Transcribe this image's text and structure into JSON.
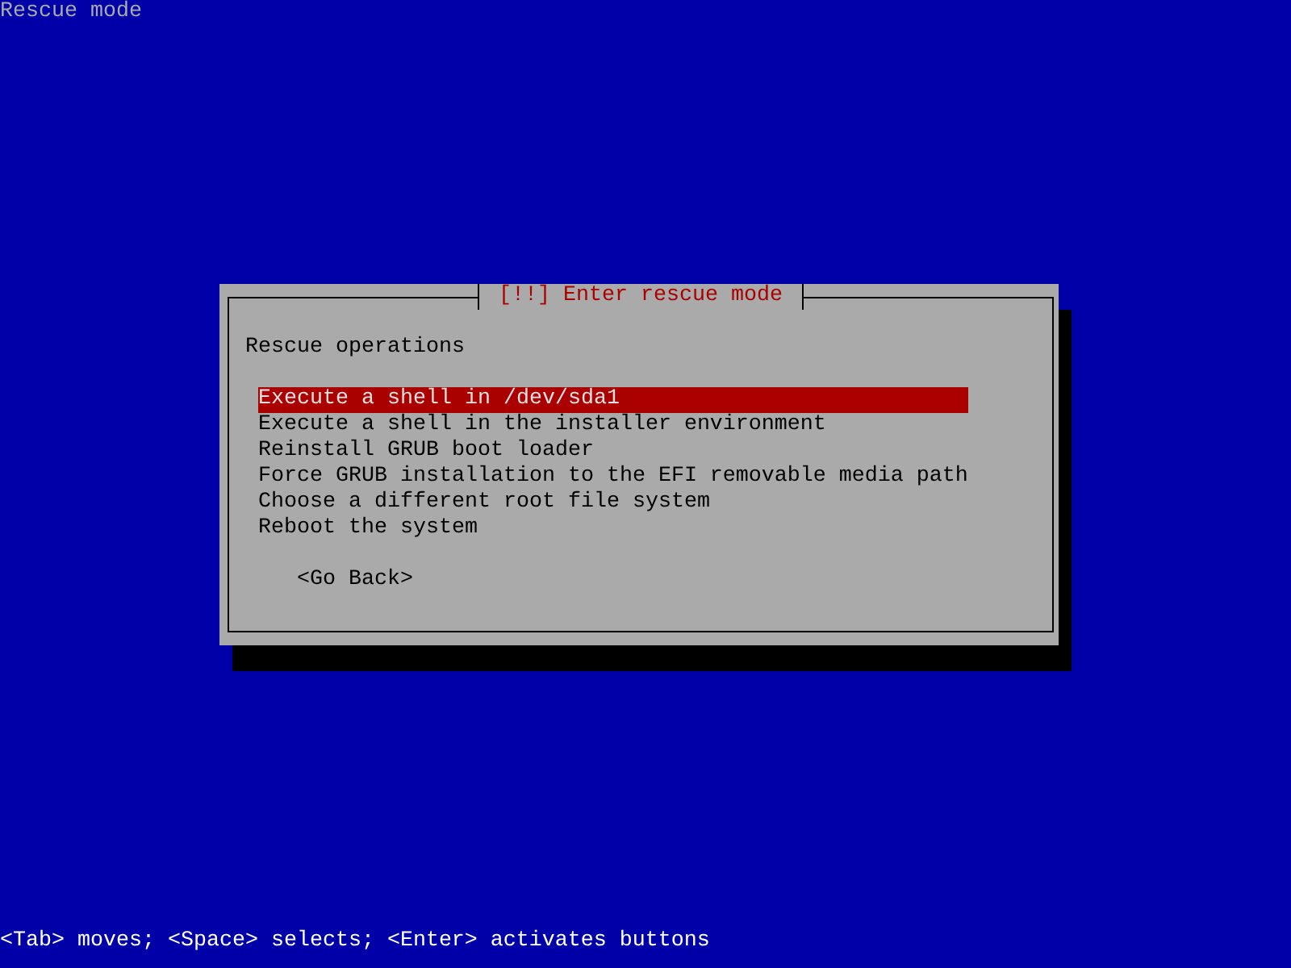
{
  "screen_title": "Rescue mode",
  "dialog": {
    "title": "[!!] Enter rescue mode",
    "prompt": "Rescue operations",
    "items": [
      {
        "label": "Execute a shell in /dev/sda1",
        "selected": true
      },
      {
        "label": "Execute a shell in the installer environment",
        "selected": false
      },
      {
        "label": "Reinstall GRUB boot loader",
        "selected": false
      },
      {
        "label": "Force GRUB installation to the EFI removable media path",
        "selected": false
      },
      {
        "label": "Choose a different root file system",
        "selected": false
      },
      {
        "label": "Reboot the system",
        "selected": false
      }
    ],
    "back_button": "<Go Back>"
  },
  "help_line": "<Tab> moves; <Space> selects; <Enter> activates buttons"
}
